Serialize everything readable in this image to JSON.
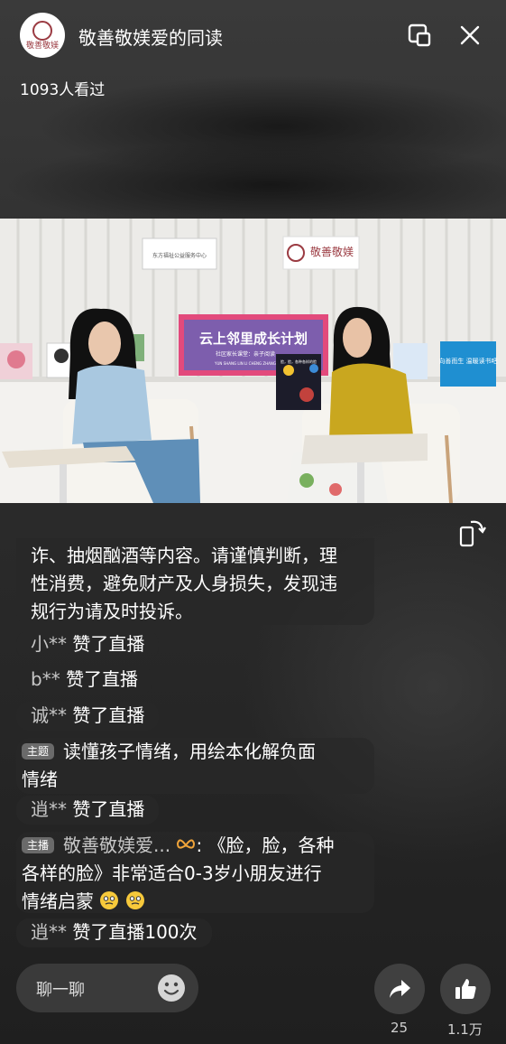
{
  "header": {
    "avatar_text": "敬善敬媄",
    "channel_name": "敬善敬媄爱的同读",
    "pip_icon": "picture-in-picture-icon",
    "close_icon": "close-icon"
  },
  "viewers": "1093人看过",
  "video": {
    "banner_title": "云上邻里成长计划",
    "banner_sub": "社区家长课堂：亲子阅读",
    "banner_pinyin": "YUN SHANG LIN LI CHENG ZHANG",
    "logo_text": "敬善敬媄",
    "sign_text": "东方福祉公益服务中心",
    "book_title": "脸，脸，各种各样的脸",
    "right_poster": "向善而生 温暖读书吧"
  },
  "rotate_icon": "rotate-screen-icon",
  "comments": [
    {
      "type": "notice",
      "text_lines": [
        "诈、抽烟酗酒等内容。请谨慎判断，理",
        "性消费，避免财产及人身损失，发现违",
        "规行为请及时投诉。"
      ]
    },
    {
      "type": "like",
      "user": "小**",
      "text": "赞了直播"
    },
    {
      "type": "like",
      "user": "b**",
      "text": "赞了直播"
    },
    {
      "type": "like",
      "user": "诚**",
      "text": "赞了直播"
    },
    {
      "type": "topic",
      "badge": "主题",
      "text_lines": [
        "读懂孩子情绪，用绘本化解负面",
        "情绪"
      ]
    },
    {
      "type": "like",
      "user": "逍**",
      "text": "赞了直播"
    },
    {
      "type": "host",
      "badge": "主播",
      "user": "敬善敬媄爱...",
      "text_lines": [
        "《脸，脸，各种",
        "各样的脸》非常适合0-3岁小朋友进行",
        "情绪启蒙"
      ]
    },
    {
      "type": "like",
      "user": "逍**",
      "text": "赞了直播100次"
    }
  ],
  "bottom": {
    "chat_placeholder": "聊一聊",
    "share_count": "25",
    "like_count": "1.1万"
  }
}
